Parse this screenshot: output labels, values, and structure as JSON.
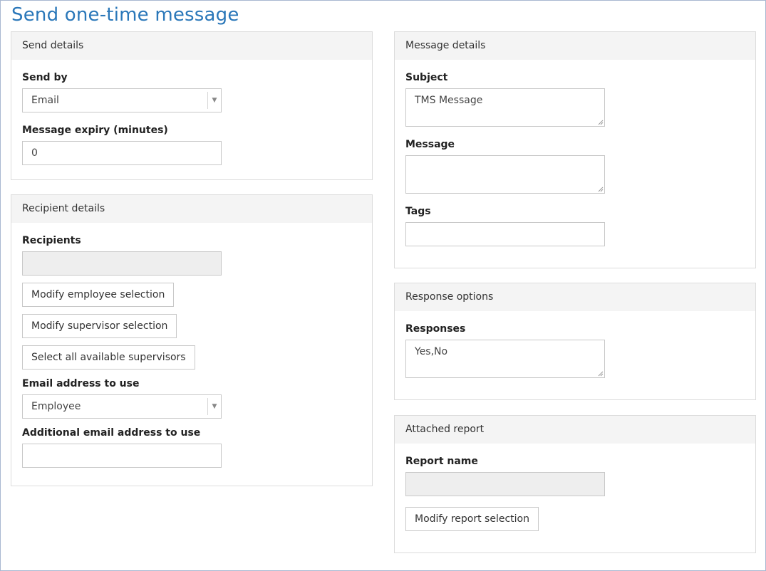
{
  "page": {
    "title": "Send one-time message"
  },
  "send_details": {
    "header": "Send details",
    "send_by_label": "Send by",
    "send_by_value": "Email",
    "expiry_label": "Message expiry (minutes)",
    "expiry_value": "0"
  },
  "recipient_details": {
    "header": "Recipient details",
    "recipients_label": "Recipients",
    "recipients_value": "",
    "modify_employee_label": "Modify employee selection",
    "modify_supervisor_label": "Modify supervisor selection",
    "select_all_supervisors_label": "Select all available supervisors",
    "email_address_label": "Email address to use",
    "email_address_value": "Employee",
    "additional_email_label": "Additional email address to use",
    "additional_email_value": ""
  },
  "message_details": {
    "header": "Message details",
    "subject_label": "Subject",
    "subject_value": "TMS Message",
    "message_label": "Message",
    "message_value": "",
    "tags_label": "Tags",
    "tags_value": ""
  },
  "response_options": {
    "header": "Response options",
    "responses_label": "Responses",
    "responses_value": "Yes,No"
  },
  "attached_report": {
    "header": "Attached report",
    "report_name_label": "Report name",
    "report_name_value": "",
    "modify_report_label": "Modify report selection"
  },
  "icons": {
    "dropdown": "dropdown-arrow-icon",
    "resize": "resize-grip-icon"
  }
}
